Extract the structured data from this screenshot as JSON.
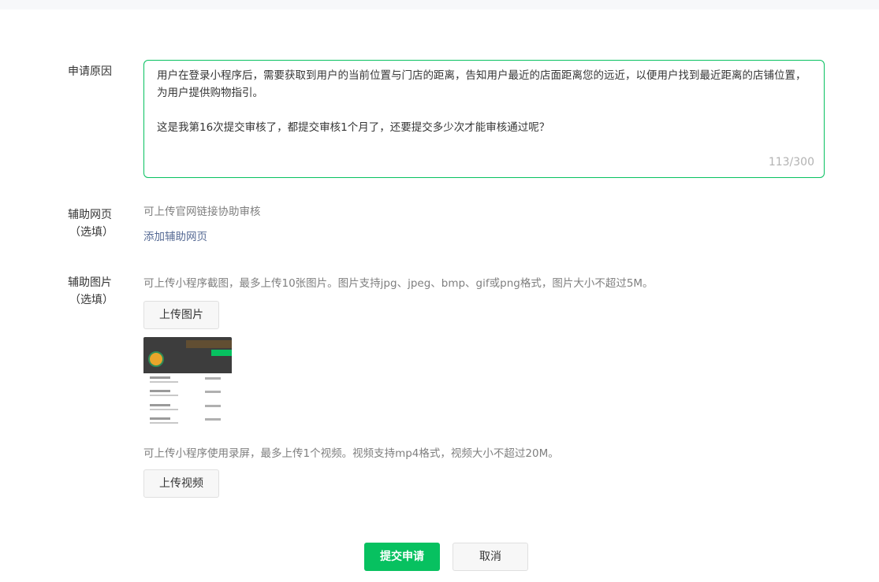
{
  "form": {
    "reason": {
      "label": "申请原因",
      "text": "用户在登录小程序后，需要获取到用户的当前位置与门店的距离，告知用户最近的店面距离您的远近，以便用户找到最近距离的店铺位置，为用户提供购物指引。\n\n这是我第16次提交审核了，都提交审核1个月了，还要提交多少次才能审核通过呢？",
      "counter": "113/300"
    },
    "webpage": {
      "label": "辅助网页",
      "optional": "（选填）",
      "hint": "可上传官网链接协助审核",
      "add_link": "添加辅助网页"
    },
    "images": {
      "label": "辅助图片",
      "optional": "（选填）",
      "hint": "可上传小程序截图，最多上传10张图片。图片支持jpg、jpeg、bmp、gif或png格式，图片大小不超过5M。",
      "upload_button": "上传图片"
    },
    "video": {
      "hint": "可上传小程序使用录屏，最多上传1个视频。视频支持mp4格式，视频大小不超过20M。",
      "upload_button": "上传视频"
    }
  },
  "actions": {
    "submit": "提交申请",
    "cancel": "取消"
  },
  "colors": {
    "primary": "#07c160",
    "link": "#576b95",
    "hint": "#7f7f7f"
  }
}
